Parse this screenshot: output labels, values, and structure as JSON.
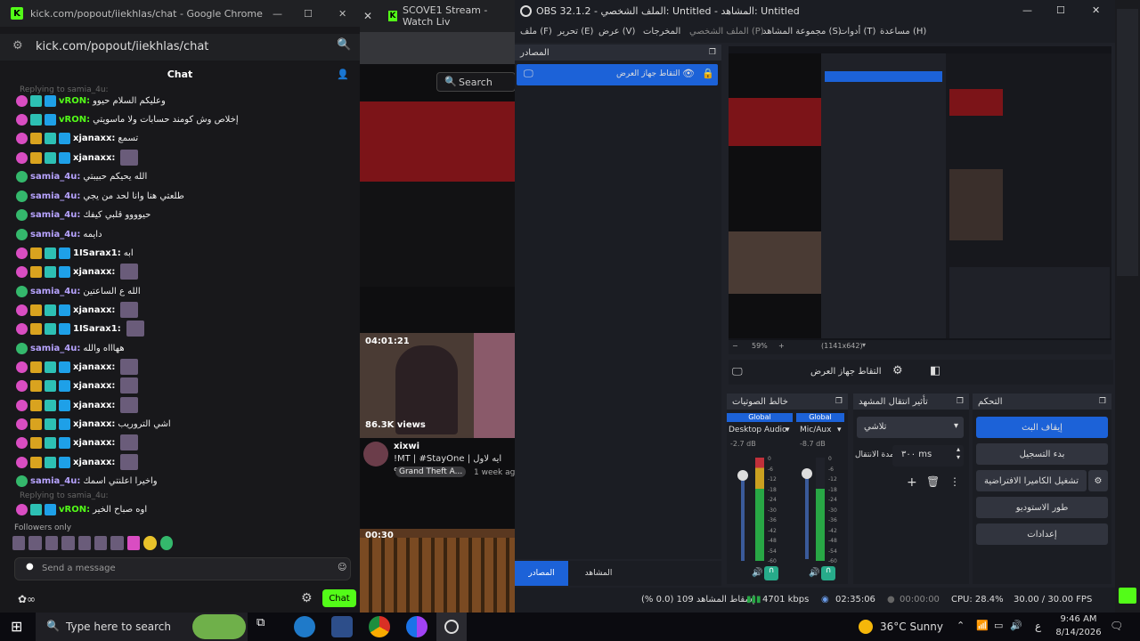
{
  "chrome": {
    "title": "kick.com/popout/iiekhlas/chat - Google Chrome",
    "url": "kick.com/popout/iiekhlas/chat",
    "chat_title": "Chat",
    "followers_only": "Followers only",
    "send_placeholder": "Send a message",
    "chat_button": "Chat"
  },
  "chat": [
    {
      "user": "vRON:",
      "text": "وعليكم السلام حيوو",
      "cls": "u-green"
    },
    {
      "user": "vRON:",
      "text": "إخلاص وش كومند حسابات ولا ماسويتي",
      "cls": "u-green"
    },
    {
      "user": "xjanaxx:",
      "text": "تسمع",
      "cls": "u-white"
    },
    {
      "user": "xjanaxx:",
      "text": "",
      "cls": "u-white"
    },
    {
      "user": "samia_4u:",
      "text": "الله يحيكم حبيبتي",
      "cls": "u-purple"
    },
    {
      "user": "samia_4u:",
      "text": "طلعتي هنا وانا لحد من يجي",
      "cls": "u-purple"
    },
    {
      "user": "samia_4u:",
      "text": "حيوووو قلبي كيفك",
      "cls": "u-purple"
    },
    {
      "user": "samia_4u:",
      "text": "دايمه",
      "cls": "u-purple"
    },
    {
      "user": "1ISarax1:",
      "text": "ابه",
      "cls": "u-white"
    },
    {
      "user": "xjanaxx:",
      "text": "",
      "cls": "u-white"
    },
    {
      "user": "samia_4u:",
      "text": "الله ع الساعتين",
      "cls": "u-purple"
    },
    {
      "user": "xjanaxx:",
      "text": "",
      "cls": "u-white"
    },
    {
      "user": "1ISarax1:",
      "text": "",
      "cls": "u-white"
    },
    {
      "user": "samia_4u:",
      "text": "ههاااه والله",
      "cls": "u-purple"
    },
    {
      "user": "xjanaxx:",
      "text": "",
      "cls": "u-white"
    },
    {
      "user": "xjanaxx:",
      "text": "",
      "cls": "u-white"
    },
    {
      "user": "xjanaxx:",
      "text": "",
      "cls": "u-white"
    },
    {
      "user": "xjanaxx:",
      "text": "اشي التروريب",
      "cls": "u-white"
    },
    {
      "user": "xjanaxx:",
      "text": "",
      "cls": "u-white"
    },
    {
      "user": "xjanaxx:",
      "text": "",
      "cls": "u-white"
    },
    {
      "user": "samia_4u:",
      "text": "واخيرا اعلنتي اسمك",
      "cls": "u-purple"
    },
    {
      "user": "vRON:",
      "text": "اوه صباح الخير",
      "cls": "u-green"
    }
  ],
  "twitch": {
    "tab1": "SCOVE1 Stream - Watch Liv",
    "search": "Search",
    "duration1": "04:01:21",
    "views": "86.3K views",
    "channel": "xixwi",
    "video_title": "!MT | #StayOne | ايه لاول مره",
    "game": "Grand Theft A...",
    "age": "1 week ag",
    "duration2": "00:30"
  },
  "obs": {
    "title": "OBS 32.1.2 - الملف الشخصي: Untitled - المشاهد: Untitled",
    "menu": [
      "ملف (F)",
      "تحرير (E)",
      "عرض (V)",
      "المخرجات",
      "الملف الشخصي (P)",
      "مجموعة المشاهد (S)",
      "أدوات (T)",
      "مساعدة (H)"
    ],
    "sources_title": "المصادر",
    "source_item": "التقاط جهاز العرض",
    "preview_zoom": "59%",
    "preview_res": "(1141x642)",
    "capture_label": "التقاط جهاز العرض",
    "mixer_title": "خالط الصوتيات",
    "mixer": [
      {
        "scope": "Global",
        "name": "Desktop Audio",
        "db": "-2.7 dB"
      },
      {
        "scope": "Global",
        "name": "Mic/Aux",
        "db": "-8.7 dB"
      }
    ],
    "meter_scale": [
      "0",
      "-6",
      "-12",
      "-18",
      "-24",
      "-30",
      "-36",
      "-42",
      "-48",
      "-54",
      "-60"
    ],
    "transitions_title": "تأثير انتقال المشهد",
    "transition": "تلاشي",
    "duration_label": "مدة الانتقال",
    "duration_value": "٣٠٠ ms",
    "controls_title": "التحكم",
    "controls": [
      "إيقاف البث",
      "بدء التسجيل",
      "تشغيل الكاميرا الافتراضية",
      "طور الاستوديو",
      "إعدادات"
    ],
    "tab_sources": "المصادر",
    "tab_scenes": "المشاهد",
    "status_dropped": "إسقاط المشاهد 109 (0.0 %)",
    "status_kbps": "4701 kbps",
    "status_time": "02:35:06",
    "status_rec": "00:00:00",
    "status_cpu": "CPU: 28.4%",
    "status_fps": "30.00 / 30.00 FPS"
  },
  "taskbar": {
    "search": "Type here to search",
    "weather": "36°C  Sunny",
    "lang": "ع",
    "time": "9:46 AM",
    "date": "8/14/2026"
  },
  "colors": {
    "kick_green": "#53fc18",
    "obs_blue": "#1c62d8"
  }
}
